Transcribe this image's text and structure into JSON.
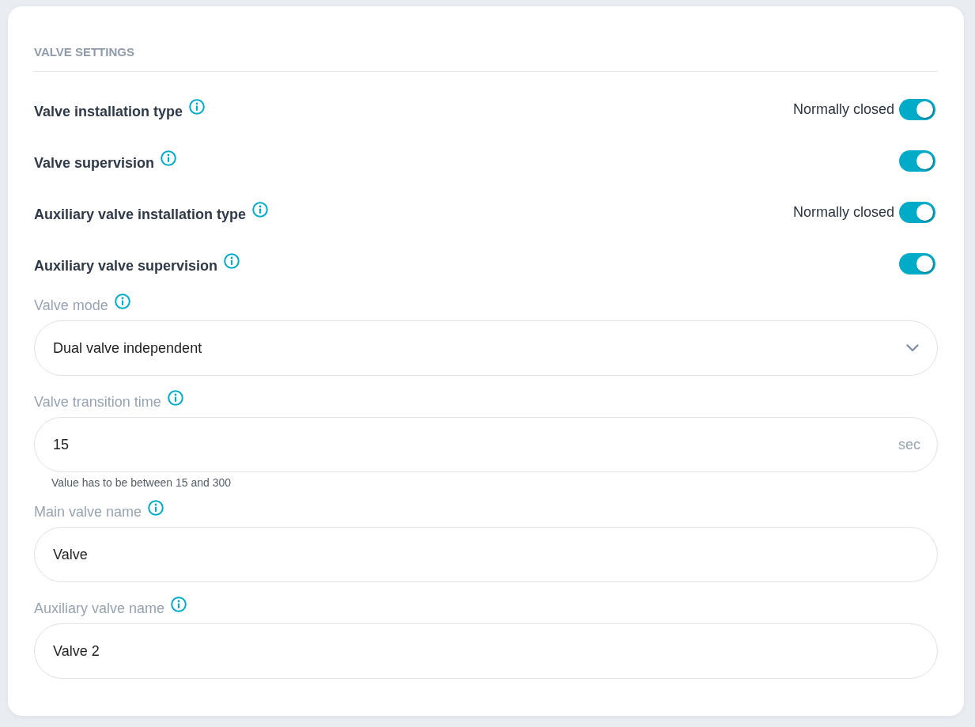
{
  "section": {
    "title": "VALVE SETTINGS"
  },
  "toggles": [
    {
      "label": "Valve installation type",
      "state_text": "Normally closed",
      "on": true
    },
    {
      "label": "Valve supervision",
      "on": true
    },
    {
      "label": "Auxiliary valve installation type",
      "state_text": "Normally closed",
      "on": true
    },
    {
      "label": "Auxiliary valve supervision",
      "on": true
    }
  ],
  "fields": [
    {
      "kind": "select",
      "label": "Valve mode",
      "value": "Dual valve independent"
    },
    {
      "kind": "number",
      "label": "Valve transition time",
      "value": "15",
      "unit": "sec",
      "hint": "Value has to be between 15 and 300"
    },
    {
      "kind": "text",
      "label": "Main valve name",
      "value": "Valve"
    },
    {
      "kind": "text",
      "label": "Auxiliary valve name",
      "value": "Valve 2"
    }
  ]
}
